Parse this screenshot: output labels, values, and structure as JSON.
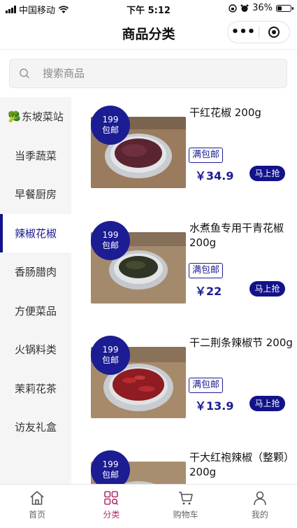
{
  "status_bar": {
    "carrier": "中国移动",
    "time": "下午 5:12",
    "battery": "36%",
    "battery_level": 0.36
  },
  "nav": {
    "title": "商品分类",
    "more_icon": "ellipsis-icon",
    "close_icon": "target-close-icon"
  },
  "search": {
    "placeholder": "搜索商品"
  },
  "sidebar": {
    "items": [
      {
        "emoji": "🥦",
        "label": "东坡菜站"
      },
      {
        "label": "当季蔬菜"
      },
      {
        "label": "早餐厨房"
      },
      {
        "label": "辣椒花椒",
        "active": true
      },
      {
        "label": "香肠腊肉"
      },
      {
        "label": "方便菜品"
      },
      {
        "label": "火锅料类"
      },
      {
        "label": "茉莉花茶"
      },
      {
        "label": "访友礼盒"
      }
    ]
  },
  "products": [
    {
      "badge_top": "199",
      "badge_bottom": "包邮",
      "name": "干红花椒 200g",
      "tag": "满包邮",
      "price": "￥34.9",
      "buy": "马上抢"
    },
    {
      "badge_top": "199",
      "badge_bottom": "包邮",
      "name": "水煮鱼专用干青花椒200g",
      "tag": "满包邮",
      "price": "￥22",
      "buy": "马上抢"
    },
    {
      "badge_top": "199",
      "badge_bottom": "包邮",
      "name": "干二荆条辣椒节 200g",
      "tag": "满包邮",
      "price": "￥13.9",
      "buy": "马上抢"
    },
    {
      "badge_top": "199",
      "badge_bottom": "包邮",
      "name": "干大红袍辣椒（整颗） 200g",
      "tag": "",
      "price": "",
      "buy": ""
    }
  ],
  "tabbar": {
    "tabs": [
      {
        "label": "首页",
        "icon": "home-icon"
      },
      {
        "label": "分类",
        "icon": "category-grid-icon",
        "active": true
      },
      {
        "label": "购物车",
        "icon": "cart-icon"
      },
      {
        "label": "我的",
        "icon": "user-icon"
      }
    ]
  },
  "colors": {
    "accent": "#1c1c93",
    "tab_active": "#b0306b"
  }
}
